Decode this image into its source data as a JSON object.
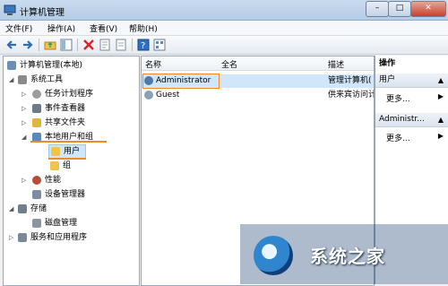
{
  "window": {
    "title": "计算机管理"
  },
  "titlebar_buttons": {
    "minimize": "–",
    "maximize": "□",
    "close": "✕"
  },
  "menu": [
    "文件(F)",
    "操作(A)",
    "查看(V)",
    "帮助(H)"
  ],
  "tree": {
    "root": "计算机管理(本地)",
    "system_tools": "系统工具",
    "task_scheduler": "任务计划程序",
    "event_viewer": "事件查看器",
    "shared_folders": "共享文件夹",
    "local_users_groups": "本地用户和组",
    "users": "用户",
    "groups": "组",
    "performance": "性能",
    "device_manager": "设备管理器",
    "storage": "存储",
    "disk_management": "磁盘管理",
    "services_apps": "服务和应用程序"
  },
  "list": {
    "columns": [
      "名称",
      "全名",
      "描述"
    ],
    "rows": [
      {
        "name": "Administrator",
        "fullname": "",
        "desc": "管理计算机("
      },
      {
        "name": "Guest",
        "fullname": "",
        "desc": "供来宾访问计"
      }
    ]
  },
  "actions": {
    "title": "操作",
    "section1": "用户",
    "more1": "更多...",
    "section2": "Administr...",
    "more2": "更多..."
  },
  "watermark": {
    "text": "系统之家"
  },
  "colors": {
    "highlight": "#f08a24",
    "selection": "#cfe6fb",
    "titlebar": "#c9dbef"
  }
}
